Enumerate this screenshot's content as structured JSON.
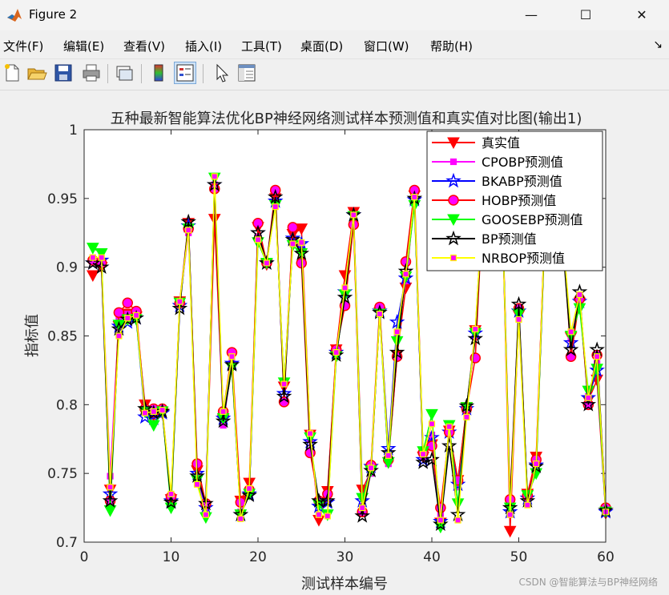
{
  "window": {
    "title": "Figure 2",
    "minimize": "—",
    "maximize": "☐",
    "close": "✕"
  },
  "menu": [
    "文件(F)",
    "编辑(E)",
    "查看(V)",
    "插入(I)",
    "工具(T)",
    "桌面(D)",
    "窗口(W)",
    "帮助(H)"
  ],
  "menu_overflow": "↘",
  "toolbar": [
    "new-figure-icon",
    "open-file-icon",
    "save-icon",
    "print-icon",
    "link-plot-icon",
    "colorbar-icon",
    "legend-icon",
    "pointer-icon",
    "property-editor-icon"
  ],
  "watermark": "CSDN @智能算法与BP神经网络",
  "chart_data": {
    "type": "line",
    "title": "五种最新智能算法优化BP神经网络测试样本预测值和真实值对比图(输出1)",
    "xlabel": "测试样本编号",
    "ylabel": "指标值",
    "xlim": [
      0,
      60
    ],
    "ylim": [
      0.7,
      1.0
    ],
    "xticks": [
      0,
      10,
      20,
      30,
      40,
      50,
      60
    ],
    "yticks": [
      0.7,
      0.75,
      0.8,
      0.85,
      0.9,
      0.95,
      1.0
    ],
    "ytick_labels": [
      "0.7",
      "0.75",
      "0.8",
      "0.85",
      "0.9",
      "0.95",
      "1"
    ],
    "grid": false,
    "legend_position": "top-right",
    "x": [
      1,
      2,
      3,
      4,
      5,
      6,
      7,
      8,
      9,
      10,
      11,
      12,
      13,
      14,
      15,
      16,
      17,
      18,
      19,
      20,
      21,
      22,
      23,
      24,
      25,
      26,
      27,
      28,
      29,
      30,
      31,
      32,
      33,
      34,
      35,
      36,
      37,
      38,
      39,
      40,
      41,
      42,
      43,
      44,
      45,
      46,
      47,
      48,
      49,
      50,
      51,
      52,
      53,
      54,
      55,
      56,
      57,
      58,
      59,
      60
    ],
    "series": [
      {
        "name": "真实值",
        "color": "#ff0000",
        "marker": "triangle-down",
        "values": [
          0.894,
          0.9,
          0.738,
          0.857,
          0.866,
          0.864,
          0.8,
          0.792,
          0.794,
          0.731,
          0.875,
          0.932,
          0.752,
          0.726,
          0.935,
          0.789,
          0.827,
          0.73,
          0.743,
          0.929,
          0.902,
          0.95,
          0.813,
          0.924,
          0.928,
          0.778,
          0.716,
          0.737,
          0.84,
          0.894,
          0.94,
          0.738,
          0.752,
          0.867,
          0.758,
          0.836,
          0.885,
          0.952,
          0.762,
          0.771,
          0.714,
          0.781,
          0.745,
          0.798,
          0.854,
          0.96,
          0.975,
          0.97,
          0.708,
          0.865,
          0.735,
          0.762,
          0.93,
          0.98,
          0.93,
          0.849,
          0.874,
          0.803,
          0.818,
          0.721
        ]
      },
      {
        "name": "CPOBP预测值",
        "color": "#ff00ff",
        "marker": "square",
        "values": [
          0.907,
          0.905,
          0.748,
          0.862,
          0.866,
          0.863,
          0.797,
          0.795,
          0.795,
          0.732,
          0.874,
          0.925,
          0.747,
          0.724,
          0.96,
          0.785,
          0.831,
          0.722,
          0.734,
          0.922,
          0.903,
          0.946,
          0.815,
          0.919,
          0.914,
          0.775,
          0.72,
          0.73,
          0.838,
          0.88,
          0.935,
          0.726,
          0.75,
          0.868,
          0.757,
          0.85,
          0.89,
          0.947,
          0.762,
          0.778,
          0.72,
          0.782,
          0.74,
          0.795,
          0.85,
          0.957,
          0.975,
          0.97,
          0.72,
          0.863,
          0.73,
          0.753,
          0.93,
          0.978,
          0.927,
          0.848,
          0.876,
          0.806,
          0.83,
          0.724
        ]
      },
      {
        "name": "BKABP预测值",
        "color": "#0000ff",
        "marker": "star",
        "values": [
          0.903,
          0.905,
          0.735,
          0.857,
          0.86,
          0.863,
          0.791,
          0.79,
          0.794,
          0.73,
          0.872,
          0.93,
          0.75,
          0.725,
          0.96,
          0.79,
          0.83,
          0.72,
          0.735,
          0.925,
          0.903,
          0.948,
          0.808,
          0.921,
          0.917,
          0.773,
          0.726,
          0.729,
          0.838,
          0.882,
          0.938,
          0.73,
          0.755,
          0.868,
          0.768,
          0.86,
          0.892,
          0.949,
          0.76,
          0.776,
          0.715,
          0.78,
          0.742,
          0.797,
          0.852,
          0.958,
          0.975,
          0.97,
          0.722,
          0.868,
          0.732,
          0.756,
          0.93,
          0.978,
          0.925,
          0.845,
          0.875,
          0.805,
          0.825,
          0.722
        ]
      },
      {
        "name": "HOBP预测值",
        "color": "#ff0000",
        "marker": "circle",
        "values": [
          0.905,
          0.903,
          0.73,
          0.867,
          0.874,
          0.868,
          0.797,
          0.797,
          0.797,
          0.733,
          0.874,
          0.928,
          0.757,
          0.728,
          0.957,
          0.795,
          0.838,
          0.729,
          0.738,
          0.932,
          0.903,
          0.956,
          0.802,
          0.929,
          0.903,
          0.765,
          0.73,
          0.735,
          0.84,
          0.872,
          0.931,
          0.722,
          0.756,
          0.871,
          0.76,
          0.835,
          0.904,
          0.956,
          0.765,
          0.77,
          0.725,
          0.78,
          0.745,
          0.797,
          0.834,
          0.962,
          0.977,
          0.972,
          0.731,
          0.87,
          0.734,
          0.76,
          0.932,
          0.98,
          0.93,
          0.835,
          0.877,
          0.8,
          0.836,
          0.725
        ]
      },
      {
        "name": "GOOSEBP预测值",
        "color": "#00ff00",
        "marker": "triangle-down",
        "values": [
          0.914,
          0.91,
          0.723,
          0.858,
          0.862,
          0.862,
          0.795,
          0.785,
          0.795,
          0.725,
          0.874,
          0.928,
          0.745,
          0.718,
          0.965,
          0.79,
          0.827,
          0.72,
          0.735,
          0.918,
          0.903,
          0.945,
          0.816,
          0.916,
          0.91,
          0.776,
          0.727,
          0.72,
          0.835,
          0.88,
          0.937,
          0.732,
          0.752,
          0.866,
          0.758,
          0.846,
          0.893,
          0.945,
          0.766,
          0.793,
          0.711,
          0.785,
          0.728,
          0.798,
          0.852,
          0.958,
          0.975,
          0.97,
          0.725,
          0.866,
          0.734,
          0.75,
          0.928,
          0.978,
          0.927,
          0.85,
          0.87,
          0.81,
          0.826,
          0.722
        ]
      },
      {
        "name": "BP预测值",
        "color": "#000000",
        "marker": "star",
        "values": [
          0.903,
          0.9,
          0.73,
          0.855,
          0.862,
          0.863,
          0.797,
          0.794,
          0.795,
          0.729,
          0.87,
          0.933,
          0.748,
          0.728,
          0.96,
          0.788,
          0.829,
          0.72,
          0.734,
          0.925,
          0.903,
          0.951,
          0.806,
          0.92,
          0.91,
          0.771,
          0.73,
          0.73,
          0.836,
          0.878,
          0.938,
          0.719,
          0.752,
          0.867,
          0.765,
          0.838,
          0.897,
          0.95,
          0.758,
          0.76,
          0.713,
          0.77,
          0.72,
          0.799,
          0.848,
          0.957,
          0.973,
          0.968,
          0.725,
          0.873,
          0.73,
          0.755,
          0.925,
          0.976,
          0.922,
          0.84,
          0.882,
          0.8,
          0.84,
          0.723
        ]
      },
      {
        "name": "NRBOP预测值",
        "color": "#ffff00",
        "marker": "square",
        "values": [
          0.907,
          0.907,
          0.74,
          0.85,
          0.863,
          0.865,
          0.794,
          0.795,
          0.796,
          0.735,
          0.875,
          0.927,
          0.742,
          0.72,
          0.966,
          0.795,
          0.835,
          0.717,
          0.739,
          0.92,
          0.903,
          0.944,
          0.815,
          0.917,
          0.918,
          0.779,
          0.72,
          0.719,
          0.838,
          0.885,
          0.938,
          0.725,
          0.754,
          0.866,
          0.763,
          0.853,
          0.895,
          0.951,
          0.764,
          0.786,
          0.716,
          0.784,
          0.716,
          0.791,
          0.855,
          0.958,
          0.975,
          0.97,
          0.72,
          0.862,
          0.727,
          0.757,
          0.93,
          0.978,
          0.928,
          0.853,
          0.88,
          0.805,
          0.835,
          0.722
        ]
      }
    ]
  }
}
